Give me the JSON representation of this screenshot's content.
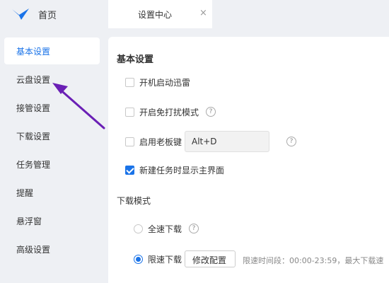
{
  "header": {
    "home_label": "首页",
    "tab_label": "设置中心",
    "tab_close": "×"
  },
  "sidebar": {
    "items": [
      {
        "label": "基本设置",
        "active": true
      },
      {
        "label": "云盘设置",
        "active": false
      },
      {
        "label": "接管设置",
        "active": false
      },
      {
        "label": "下载设置",
        "active": false
      },
      {
        "label": "任务管理",
        "active": false
      },
      {
        "label": "提醒",
        "active": false
      },
      {
        "label": "悬浮窗",
        "active": false
      },
      {
        "label": "高级设置",
        "active": false
      }
    ]
  },
  "main": {
    "section_title": "基本设置",
    "options": [
      {
        "label": "开机启动迅雷",
        "checked": false
      },
      {
        "label": "开启免打扰模式",
        "checked": false
      },
      {
        "label": "启用老板键",
        "checked": false
      },
      {
        "label": "新建任务时显示主界面",
        "checked": true
      }
    ],
    "hotkey_value": "Alt+D",
    "help_glyph": "?",
    "download_mode_title": "下载模式",
    "modes": [
      {
        "label": "全速下载",
        "selected": false
      },
      {
        "label": "限速下载",
        "selected": true
      }
    ],
    "modify_button": "修改配置",
    "limit_info": "限速时间段：00:00-23:59，最大下载速"
  },
  "colors": {
    "accent": "#1a73e8",
    "annotation_arrow": "#6a1fb5"
  },
  "icons": [
    "app-logo-icon",
    "close-icon",
    "help-icon",
    "annotation-arrow"
  ]
}
